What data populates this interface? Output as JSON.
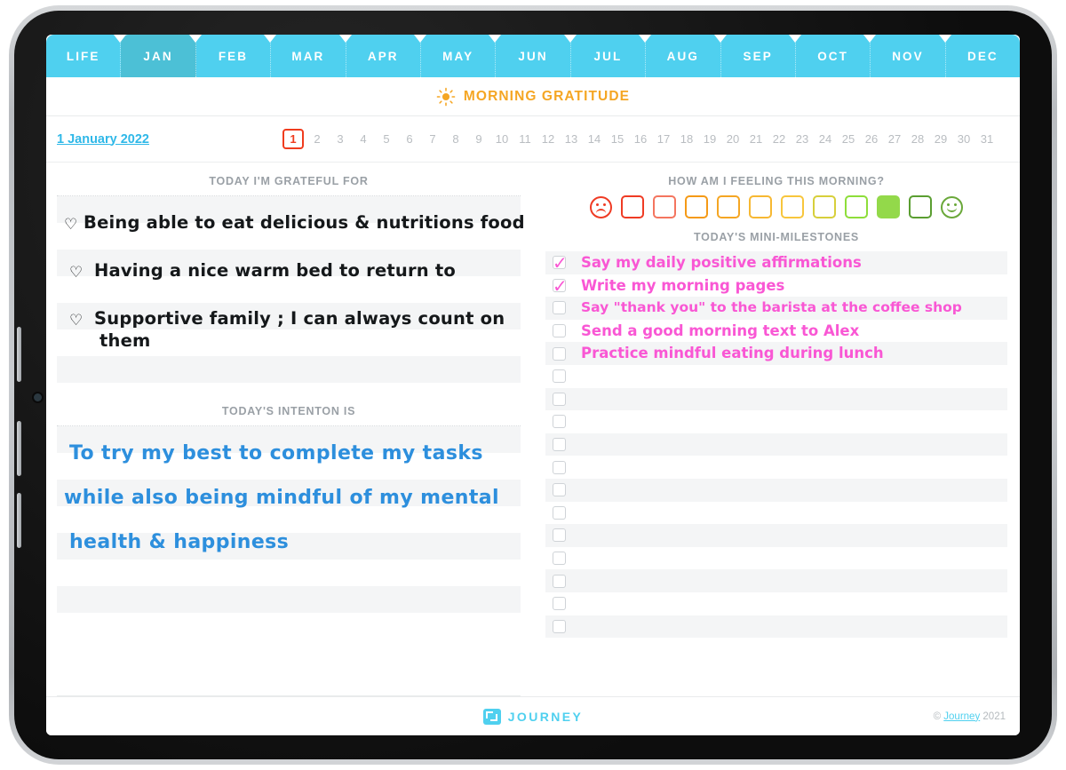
{
  "tabs": [
    {
      "label": "LIFE",
      "active": false
    },
    {
      "label": "JAN",
      "active": true
    },
    {
      "label": "FEB",
      "active": false
    },
    {
      "label": "MAR",
      "active": false
    },
    {
      "label": "APR",
      "active": false
    },
    {
      "label": "MAY",
      "active": false
    },
    {
      "label": "JUN",
      "active": false
    },
    {
      "label": "JUL",
      "active": false
    },
    {
      "label": "AUG",
      "active": false
    },
    {
      "label": "SEP",
      "active": false
    },
    {
      "label": "OCT",
      "active": false
    },
    {
      "label": "NOV",
      "active": false
    },
    {
      "label": "DEC",
      "active": false
    }
  ],
  "header": {
    "title": "MORNING GRATITUDE",
    "icon": "sun-icon",
    "title_color": "#f5a623"
  },
  "date_bar": {
    "date_label": "1 January 2022",
    "date_color": "#2fb8e8",
    "selected_day": "1",
    "selected_color": "#f03c1e",
    "days": [
      "1",
      "2",
      "3",
      "4",
      "5",
      "6",
      "7",
      "8",
      "9",
      "10",
      "11",
      "12",
      "13",
      "14",
      "15",
      "16",
      "17",
      "18",
      "19",
      "20",
      "21",
      "22",
      "23",
      "24",
      "25",
      "26",
      "27",
      "28",
      "29",
      "30",
      "31"
    ]
  },
  "gratitude": {
    "label": "TODAY I'M GRATEFUL FOR",
    "bullet": "♡",
    "entries": [
      "Being able to eat delicious & nutritions food",
      "Having a nice warm bed to return to",
      "Supportive family ; I can always count on",
      "them"
    ]
  },
  "intention": {
    "label": "TODAY'S INTENTON IS",
    "lines": [
      "To try my best to complete my tasks",
      "while also being mindful of my mental",
      "health & happiness"
    ]
  },
  "mood": {
    "label": "HOW AM I FEELING THIS MORNING?",
    "sad_face": "sad-face-icon",
    "happy_face": "happy-face-icon",
    "selected_index": 8,
    "colors": [
      "#ef3b24",
      "#f4755f",
      "#f59a16",
      "#f5a623",
      "#f7b832",
      "#f8c63c",
      "#d7cf3b",
      "#8ede3a",
      "#93d94a",
      "#5a9e31"
    ],
    "face_sad_color": "#ef3b24",
    "face_happy_color": "#6aa83a"
  },
  "milestones": {
    "label": "TODAY'S MINI-MILESTONES",
    "check_mark": "✓",
    "items": [
      {
        "text": "Say my daily positive affirmations",
        "checked": true
      },
      {
        "text": "Write my morning pages",
        "checked": true
      },
      {
        "text": "Say \"thank you\" to the barista at the coffee shop",
        "checked": false
      },
      {
        "text": "Send a good morning text to Alex",
        "checked": false
      },
      {
        "text": "Practice mindful eating during lunch",
        "checked": false
      },
      {
        "text": "",
        "checked": false
      },
      {
        "text": "",
        "checked": false
      },
      {
        "text": "",
        "checked": false
      },
      {
        "text": "",
        "checked": false
      },
      {
        "text": "",
        "checked": false
      },
      {
        "text": "",
        "checked": false
      },
      {
        "text": "",
        "checked": false
      },
      {
        "text": "",
        "checked": false
      },
      {
        "text": "",
        "checked": false
      },
      {
        "text": "",
        "checked": false
      },
      {
        "text": "",
        "checked": false
      },
      {
        "text": "",
        "checked": false
      }
    ]
  },
  "footer": {
    "brand": "JOURNEY",
    "copyright_prefix": "©",
    "copyright_link": "Journey",
    "copyright_year": "2021",
    "brand_color": "#4fd0ef"
  }
}
